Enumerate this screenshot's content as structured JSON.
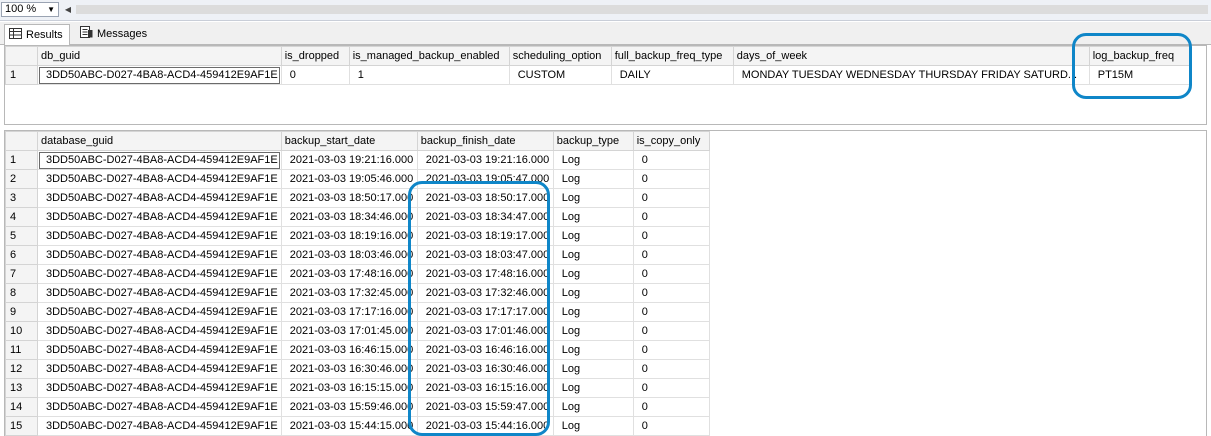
{
  "toolbar": {
    "zoom_value": "100 %",
    "zoom_dropdown_icon": "chevron-down-icon",
    "scroll_left_icon": "triangle-left-icon"
  },
  "tabs": [
    {
      "label": "Results",
      "icon": "grid-icon",
      "active": true
    },
    {
      "label": "Messages",
      "icon": "messages-icon",
      "active": false
    }
  ],
  "grid1": {
    "columns": [
      "db_guid",
      "is_dropped",
      "is_managed_backup_enabled",
      "scheduling_option",
      "full_backup_freq_type",
      "days_of_week",
      "log_backup_freq"
    ],
    "rows": [
      {
        "n": "1",
        "cells": [
          "3DD50ABC-D027-4BA8-ACD4-459412E9AF1E",
          "0",
          "1",
          "CUSTOM",
          "DAILY",
          "MONDAY TUESDAY WEDNESDAY THURSDAY FRIDAY SATURD...",
          "PT15M"
        ]
      }
    ]
  },
  "grid2": {
    "columns": [
      "database_guid",
      "backup_start_date",
      "backup_finish_date",
      "backup_type",
      "is_copy_only"
    ],
    "rows": [
      {
        "n": "1",
        "cells": [
          "3DD50ABC-D027-4BA8-ACD4-459412E9AF1E",
          "2021-03-03 19:21:16.000",
          "2021-03-03 19:21:16.000",
          "Log",
          "0"
        ]
      },
      {
        "n": "2",
        "cells": [
          "3DD50ABC-D027-4BA8-ACD4-459412E9AF1E",
          "2021-03-03 19:05:46.000",
          "2021-03-03 19:05:47.000",
          "Log",
          "0"
        ]
      },
      {
        "n": "3",
        "cells": [
          "3DD50ABC-D027-4BA8-ACD4-459412E9AF1E",
          "2021-03-03 18:50:17.000",
          "2021-03-03 18:50:17.000",
          "Log",
          "0"
        ]
      },
      {
        "n": "4",
        "cells": [
          "3DD50ABC-D027-4BA8-ACD4-459412E9AF1E",
          "2021-03-03 18:34:46.000",
          "2021-03-03 18:34:47.000",
          "Log",
          "0"
        ]
      },
      {
        "n": "5",
        "cells": [
          "3DD50ABC-D027-4BA8-ACD4-459412E9AF1E",
          "2021-03-03 18:19:16.000",
          "2021-03-03 18:19:17.000",
          "Log",
          "0"
        ]
      },
      {
        "n": "6",
        "cells": [
          "3DD50ABC-D027-4BA8-ACD4-459412E9AF1E",
          "2021-03-03 18:03:46.000",
          "2021-03-03 18:03:47.000",
          "Log",
          "0"
        ]
      },
      {
        "n": "7",
        "cells": [
          "3DD50ABC-D027-4BA8-ACD4-459412E9AF1E",
          "2021-03-03 17:48:16.000",
          "2021-03-03 17:48:16.000",
          "Log",
          "0"
        ]
      },
      {
        "n": "8",
        "cells": [
          "3DD50ABC-D027-4BA8-ACD4-459412E9AF1E",
          "2021-03-03 17:32:45.000",
          "2021-03-03 17:32:46.000",
          "Log",
          "0"
        ]
      },
      {
        "n": "9",
        "cells": [
          "3DD50ABC-D027-4BA8-ACD4-459412E9AF1E",
          "2021-03-03 17:17:16.000",
          "2021-03-03 17:17:17.000",
          "Log",
          "0"
        ]
      },
      {
        "n": "10",
        "cells": [
          "3DD50ABC-D027-4BA8-ACD4-459412E9AF1E",
          "2021-03-03 17:01:45.000",
          "2021-03-03 17:01:46.000",
          "Log",
          "0"
        ]
      },
      {
        "n": "11",
        "cells": [
          "3DD50ABC-D027-4BA8-ACD4-459412E9AF1E",
          "2021-03-03 16:46:15.000",
          "2021-03-03 16:46:16.000",
          "Log",
          "0"
        ]
      },
      {
        "n": "12",
        "cells": [
          "3DD50ABC-D027-4BA8-ACD4-459412E9AF1E",
          "2021-03-03 16:30:46.000",
          "2021-03-03 16:30:46.000",
          "Log",
          "0"
        ]
      },
      {
        "n": "13",
        "cells": [
          "3DD50ABC-D027-4BA8-ACD4-459412E9AF1E",
          "2021-03-03 16:15:15.000",
          "2021-03-03 16:15:16.000",
          "Log",
          "0"
        ]
      },
      {
        "n": "14",
        "cells": [
          "3DD50ABC-D027-4BA8-ACD4-459412E9AF1E",
          "2021-03-03 15:59:46.000",
          "2021-03-03 15:59:47.000",
          "Log",
          "0"
        ]
      },
      {
        "n": "15",
        "cells": [
          "3DD50ABC-D027-4BA8-ACD4-459412E9AF1E",
          "2021-03-03 15:44:15.000",
          "2021-03-03 15:44:16.000",
          "Log",
          "0"
        ]
      }
    ]
  },
  "colors": {
    "highlight": "#0f86c8",
    "header_bg": "#f4f4f4",
    "grid_border": "#e0e0e0"
  }
}
